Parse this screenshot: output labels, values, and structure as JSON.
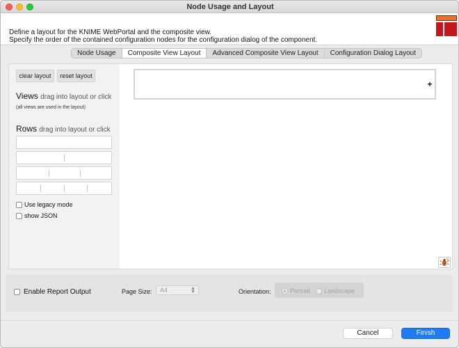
{
  "window": {
    "title": "Node Usage and Layout"
  },
  "header": {
    "line1": "Define a layout for the KNIME WebPortal and the composite view.",
    "line2": "Specify the order of the contained configuration nodes for the configuration dialog of the component.",
    "logo_icon": "knime-logo-icon"
  },
  "tabs": [
    {
      "label": "Node Usage",
      "active": false
    },
    {
      "label": "Composite View Layout",
      "active": true
    },
    {
      "label": "Advanced Composite View Layout",
      "active": false
    },
    {
      "label": "Configuration Dialog Layout",
      "active": false
    }
  ],
  "sidebar": {
    "clear_label": "clear layout",
    "reset_label": "reset layout",
    "views_title": "Views",
    "views_hint": "drag into layout or click",
    "views_note": "(all views are used in the layout)",
    "rows_title": "Rows",
    "rows_hint": "drag into layout or click",
    "legacy_label": "Use legacy mode",
    "json_label": "show JSON"
  },
  "layout": {
    "add_column_symbol": "+",
    "debug_icon": "bug-icon"
  },
  "report": {
    "enable_label": "Enable Report Output",
    "page_size_label": "Page Size:",
    "page_size_value": "A4",
    "orientation_label": "Orientation:",
    "portrait_label": "Portrait",
    "landscape_label": "Landscape",
    "selected_orientation": "Portrait"
  },
  "footer": {
    "cancel_label": "Cancel",
    "finish_label": "Finish"
  },
  "colors": {
    "accent": "#1f7bf2",
    "logo_orange": "#e9722c",
    "logo_red": "#c4161c"
  }
}
